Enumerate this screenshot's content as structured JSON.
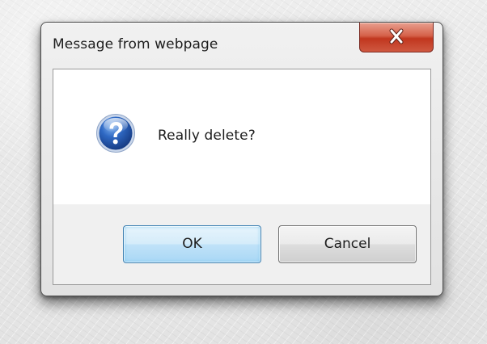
{
  "dialog": {
    "title": "Message from webpage",
    "close_icon": "close-icon",
    "message": "Really delete?",
    "message_icon": "question-icon",
    "buttons": {
      "ok_label": "OK",
      "cancel_label": "Cancel"
    }
  },
  "colors": {
    "close_button": "#c7432b",
    "default_button_accent": "#3c7fb1",
    "question_icon": "#2a5fb2"
  }
}
